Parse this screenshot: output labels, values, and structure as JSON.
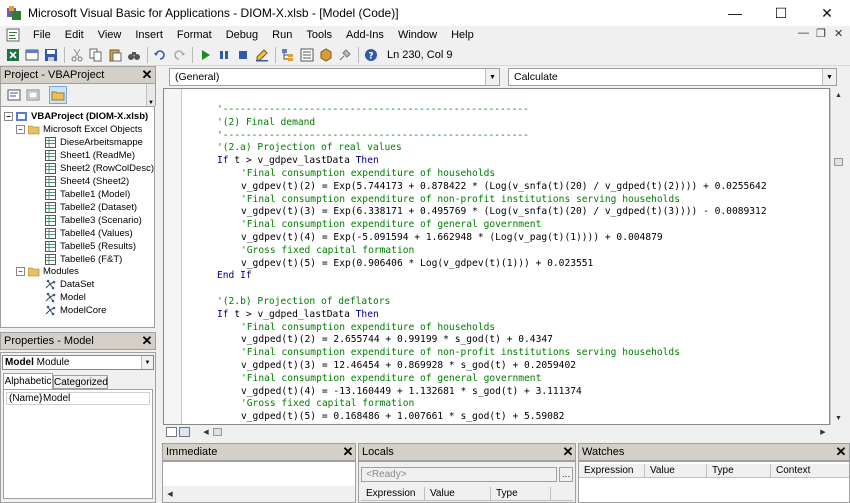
{
  "window": {
    "title": "Microsoft Visual Basic for Applications - DIOM-X.xlsb - [Model (Code)]",
    "minimize": "—",
    "maximize": "☐",
    "close": "✕"
  },
  "menu": {
    "items": [
      "File",
      "Edit",
      "View",
      "Insert",
      "Format",
      "Debug",
      "Run",
      "Tools",
      "Add-Ins",
      "Window",
      "Help"
    ],
    "mdi_min": "—",
    "mdi_restore": "❐",
    "mdi_close": "✕"
  },
  "toolbar": {
    "icons": [
      "view-excel-icon",
      "insert-userform-icon",
      "save-icon",
      "cut-icon",
      "copy-icon",
      "paste-icon",
      "find-icon",
      "undo-icon",
      "redo-icon",
      "run-icon",
      "break-icon",
      "reset-icon",
      "design-mode-icon",
      "project-explorer-icon",
      "properties-icon",
      "object-browser-icon",
      "toolbox-icon",
      "help-icon"
    ],
    "position": "Ln 230, Col 9"
  },
  "project": {
    "title": "Project - VBAProject",
    "root": "VBAProject (DIOM-X.xlsb)",
    "excel_folder": "Microsoft Excel Objects",
    "objects": [
      "DieseArbeitsmappe",
      "Sheet1 (ReadMe)",
      "Sheet2 (RowColDesc)",
      "Sheet4 (Sheet2)",
      "Tabelle1 (Model)",
      "Tabelle2 (Dataset)",
      "Tabelle3 (Scenario)",
      "Tabelle4 (Values)",
      "Tabelle5 (Results)",
      "Tabelle6 (F&T)"
    ],
    "modules_folder": "Modules",
    "modules": [
      "DataSet",
      "Model",
      "ModelCore"
    ]
  },
  "properties": {
    "title": "Properties - Model",
    "object_name": "Model",
    "object_type": "Module",
    "tabs": [
      "Alphabetic",
      "Categorized"
    ],
    "rows": [
      {
        "name": "(Name)",
        "value": "Model"
      }
    ]
  },
  "code": {
    "object_dropdown": "(General)",
    "procedure_dropdown": "Calculate",
    "lines": [
      {
        "indent": 0,
        "type": "comment",
        "text": "'-----------------------------------------------------"
      },
      {
        "indent": 0,
        "type": "comment",
        "text": "'(2) Final demand"
      },
      {
        "indent": 0,
        "type": "comment",
        "text": "'-----------------------------------------------------"
      },
      {
        "indent": 0,
        "type": "comment",
        "text": "'(2.a) Projection of real values"
      },
      {
        "indent": 0,
        "type": "kw",
        "text": "If t > v_gdpev_lastData Then"
      },
      {
        "indent": 1,
        "type": "comment",
        "text": "'Final consumption expenditure of households"
      },
      {
        "indent": 1,
        "type": "plain",
        "text": "v_gdpev(t)(2) = Exp(5.744173 + 0.878422 * (Log(v_snfa(t)(20) / v_gdped(t)(2)))) + 0.0255642"
      },
      {
        "indent": 1,
        "type": "comment",
        "text": "'Final consumption expenditure of non-profit institutions serving households"
      },
      {
        "indent": 1,
        "type": "plain",
        "text": "v_gdpev(t)(3) = Exp(6.338171 + 0.495769 * (Log(v_snfa(t)(20) / v_gdped(t)(3)))) - 0.0089312"
      },
      {
        "indent": 1,
        "type": "comment",
        "text": "'Final consumption expenditure of general government"
      },
      {
        "indent": 1,
        "type": "plain",
        "text": "v_gdpev(t)(4) = Exp(-5.091594 + 1.662948 * (Log(v_pag(t)(1)))) + 0.004879"
      },
      {
        "indent": 1,
        "type": "comment",
        "text": "'Gross fixed capital formation"
      },
      {
        "indent": 1,
        "type": "plain",
        "text": "v_gdpev(t)(5) = Exp(0.906406 * Log(v_gdpev(t)(1))) + 0.023551"
      },
      {
        "indent": 0,
        "type": "kw",
        "text": "End If"
      },
      {
        "indent": 0,
        "type": "plain",
        "text": ""
      },
      {
        "indent": 0,
        "type": "comment",
        "text": "'(2.b) Projection of deflators"
      },
      {
        "indent": 0,
        "type": "kw",
        "text": "If t > v_gdped_lastData Then"
      },
      {
        "indent": 1,
        "type": "comment",
        "text": "'Final consumption expenditure of households"
      },
      {
        "indent": 1,
        "type": "plain",
        "text": "v_gdped(t)(2) = 2.655744 + 0.99199 * s_god(t) + 0.4347"
      },
      {
        "indent": 1,
        "type": "comment",
        "text": "'Final consumption expenditure of non-profit institutions serving households"
      },
      {
        "indent": 1,
        "type": "plain",
        "text": "v_gdped(t)(3) = 12.46454 + 0.869928 * s_god(t) + 0.2059402"
      },
      {
        "indent": 1,
        "type": "comment",
        "text": "'Final consumption expenditure of general government"
      },
      {
        "indent": 1,
        "type": "plain",
        "text": "v_gdped(t)(4) = -13.160449 + 1.132681 * s_god(t) + 3.111374"
      },
      {
        "indent": 1,
        "type": "comment",
        "text": "'Gross fixed capital formation"
      },
      {
        "indent": 1,
        "type": "plain",
        "text": "v_gdped(t)(5) = 0.168486 + 1.007661 * s_god(t) + 5.59082"
      }
    ]
  },
  "immediate": {
    "title": "Immediate"
  },
  "locals": {
    "title": "Locals",
    "context": "<Ready>",
    "columns": [
      "Expression",
      "Value",
      "Type"
    ]
  },
  "watches": {
    "title": "Watches",
    "columns": [
      "Expression",
      "Value",
      "Type",
      "Context"
    ]
  }
}
